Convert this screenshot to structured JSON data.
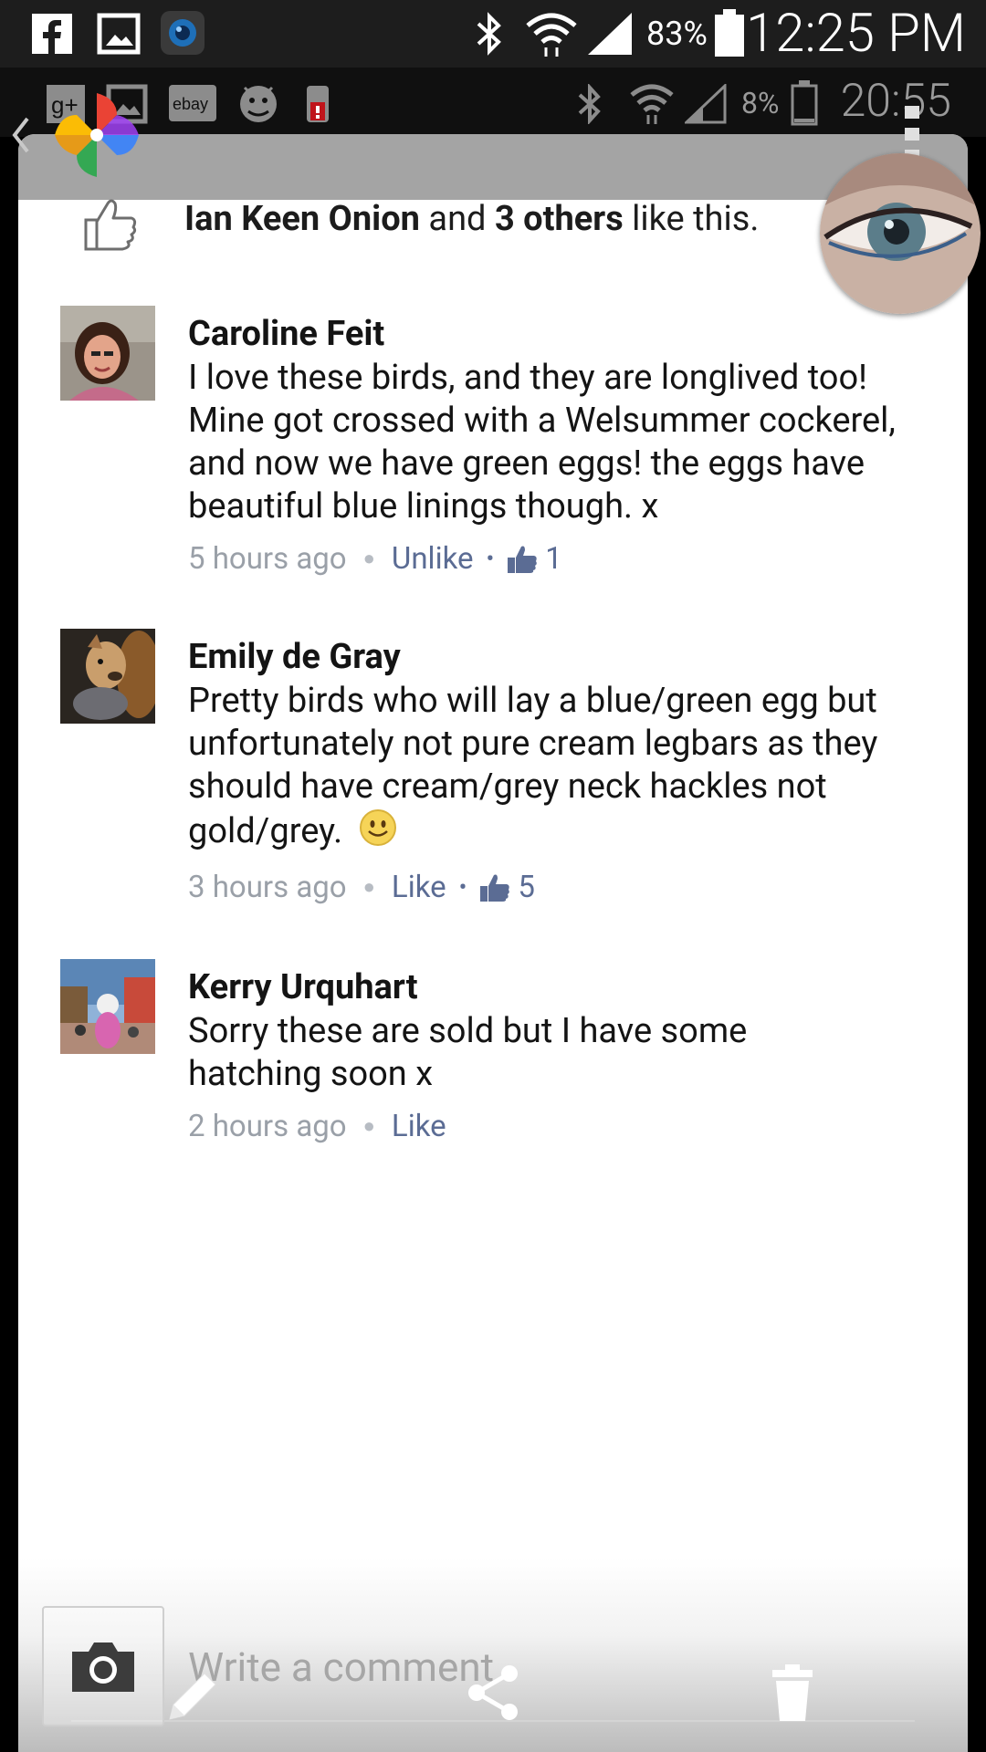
{
  "status_bar_top": {
    "battery_percent": "83%",
    "time": "12:25 PM",
    "icons": [
      "facebook-icon",
      "gallery-icon",
      "camera-app-icon",
      "bluetooth-icon",
      "wifi-icon",
      "signal-icon",
      "battery-icon"
    ]
  },
  "status_bar_inner": {
    "battery_percent": "8%",
    "time": "20:55",
    "ebay_label": "ebay",
    "icons": [
      "google-plus-icon",
      "gallery-icon",
      "ebay-icon",
      "android-icon",
      "alert-icon",
      "bluetooth-icon",
      "wifi-icon",
      "signal-icon",
      "battery-icon"
    ]
  },
  "likes": {
    "name": "Ian Keen Onion",
    "connector": "and",
    "others": "3 others",
    "suffix": "like this."
  },
  "comments": [
    {
      "author": "Caroline Feit",
      "text": "I love these birds, and they are longlived too! Mine got crossed with a Welsummer cockerel, and now we have green eggs! the eggs have beautiful blue linings though. x",
      "time": "5 hours ago",
      "action": "Unlike",
      "like_count": "1"
    },
    {
      "author": "Emily de Gray",
      "text": "Pretty birds who will lay a blue/green egg but unfortunately not pure cream legbars as they should have cream/grey neck hackles not gold/grey.",
      "time": "3 hours ago",
      "action": "Like",
      "like_count": "5"
    },
    {
      "author": "Kerry Urquhart",
      "text": "Sorry these are sold but I have some hatching soon x",
      "time": "2 hours ago",
      "action": "Like"
    }
  ],
  "composer": {
    "placeholder": "Write a comment"
  },
  "colors": {
    "link": "#5b6c94",
    "meta_gray": "#9aa0a8",
    "status_bg": "#1d1d1d"
  }
}
